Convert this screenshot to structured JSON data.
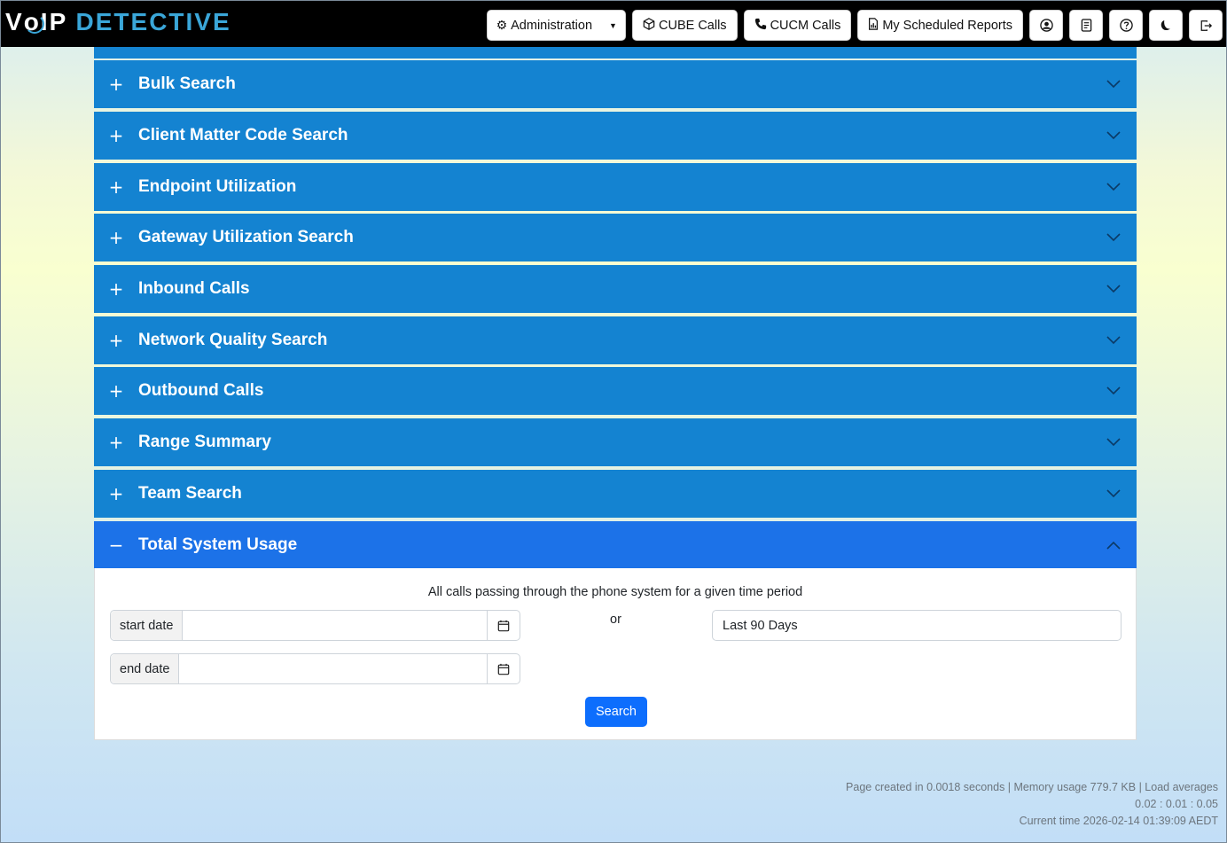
{
  "header": {
    "logo_prefix": "V",
    "logo_o": "o",
    "logo_ip": "IP",
    "logo_detective": "DETECTIVE",
    "nav": {
      "administration": "Administration",
      "cube_calls": "CUBE Calls",
      "cucm_calls": "CUCM Calls",
      "scheduled_reports": "My Scheduled Reports"
    }
  },
  "accordion": {
    "items": [
      {
        "label": "Bulk Search",
        "sign": "+"
      },
      {
        "label": "Client Matter Code Search",
        "sign": "+"
      },
      {
        "label": "Endpoint Utilization",
        "sign": "+"
      },
      {
        "label": "Gateway Utilization Search",
        "sign": "+"
      },
      {
        "label": "Inbound Calls",
        "sign": "+"
      },
      {
        "label": "Network Quality Search",
        "sign": "+"
      },
      {
        "label": "Outbound Calls",
        "sign": "+"
      },
      {
        "label": "Range Summary",
        "sign": "+"
      },
      {
        "label": "Team Search",
        "sign": "+"
      },
      {
        "label": "Total System Usage",
        "sign": "−"
      }
    ]
  },
  "form": {
    "description": "All calls passing through the phone system for a given time period",
    "start_label": "start date",
    "start_value": "",
    "end_label": "end date",
    "end_value": "",
    "or_text": "or",
    "range_selected": "Last 90 Days",
    "search_label": "Search"
  },
  "footer": {
    "line1": "Page created in 0.0018 seconds | Memory usage 779.7 KB | Load averages",
    "line2": "0.02 : 0.01 : 0.05",
    "line3": "Current time 2026-02-14 01:39:09 AEDT"
  },
  "colors": {
    "accordion_bg": "#1483d1",
    "accordion_open_bg": "#1c72e8",
    "primary": "#0d6efd",
    "logo_accent": "#3aa6d8"
  }
}
